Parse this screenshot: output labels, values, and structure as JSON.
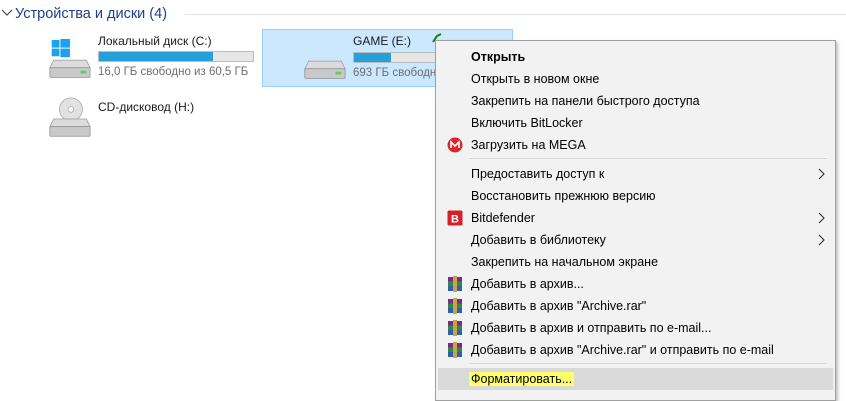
{
  "group": {
    "title": "Устройства и диски (4)"
  },
  "drives": [
    {
      "name": "Локальный диск (C:)",
      "free": "16,0 ГБ свободно из 60,5 ГБ",
      "usage": 0.74
    },
    {
      "name": "GAME (E:)",
      "free": "693 ГБ свободно",
      "usage": 0.25
    },
    {
      "name": "CD-дисковод (H:)"
    }
  ],
  "partial_drive_label": "...",
  "menu": {
    "items": [
      {
        "label": "Открыть"
      },
      {
        "label": "Открыть в новом окне"
      },
      {
        "label": "Закрепить на панели быстрого доступа"
      },
      {
        "label": "Включить BitLocker"
      },
      {
        "label": "Загрузить на MEGA",
        "icon": "mega-icon"
      },
      {
        "label": "Предоставить доступ к"
      },
      {
        "label": "Восстановить прежнюю версию"
      },
      {
        "label": "Bitdefender",
        "icon": "bitdefender-icon"
      },
      {
        "label": "Добавить в библиотеку"
      },
      {
        "label": "Закрепить на начальном экране"
      },
      {
        "label": "Добавить в архив...",
        "icon": "winrar-icon"
      },
      {
        "label": "Добавить в архив \"Archive.rar\"",
        "icon": "winrar-icon"
      },
      {
        "label": "Добавить в архив и отправить по e-mail...",
        "icon": "winrar-icon"
      },
      {
        "label": "Добавить в архив \"Archive.rar\" и отправить по e-mail",
        "icon": "winrar-icon"
      },
      {
        "label": "Форматировать..."
      }
    ]
  },
  "colors": {
    "selection": "#cce8ff",
    "bar_fill": "#26a0da",
    "highlight": "#ffff6e",
    "header_text": "#1e3f8a"
  }
}
